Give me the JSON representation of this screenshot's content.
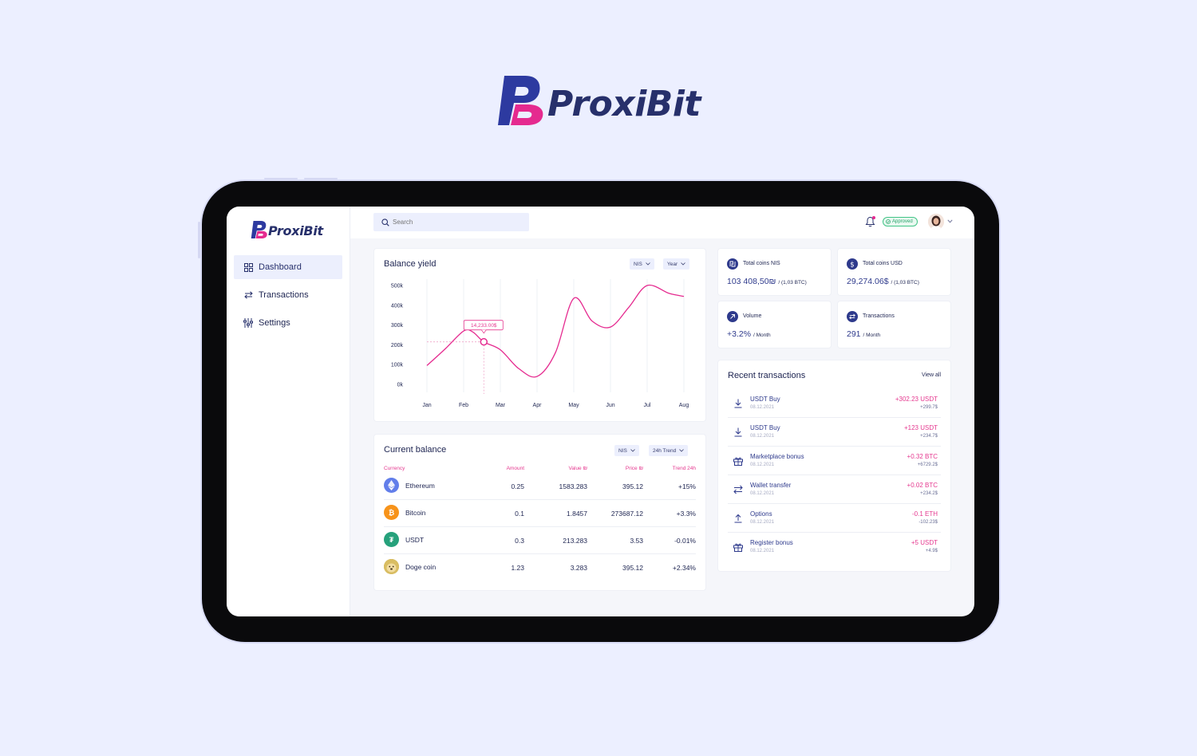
{
  "brand": {
    "name": "ProxiBit",
    "colors": {
      "primary": "#2d3aa0",
      "accent": "#e52a8f",
      "text": "#27306b"
    }
  },
  "sidebar": {
    "items": [
      {
        "label": "Dashboard",
        "icon": "grid-icon",
        "active": true
      },
      {
        "label": "Transactions",
        "icon": "arrows-swap-icon",
        "active": false
      },
      {
        "label": "Settings",
        "icon": "sliders-icon",
        "active": false
      }
    ]
  },
  "topbar": {
    "search_placeholder": "Search",
    "status_badge": "Approved"
  },
  "balance_yield": {
    "title": "Balance yield",
    "currency_filter": "NIS",
    "period_filter": "Year",
    "tooltip": "14,233.00$"
  },
  "chart_data": {
    "type": "line",
    "title": "Balance yield",
    "categories": [
      "Jan",
      "Feb",
      "Mar",
      "Apr",
      "May",
      "Jun",
      "Jul",
      "Aug"
    ],
    "y_ticks": [
      "500k",
      "400k",
      "300k",
      "200k",
      "100k",
      "0k"
    ],
    "ylim": [
      0,
      500000
    ],
    "series": [
      {
        "color": "#e52a8f",
        "x": [
          0,
          0.5,
          1,
          1.25,
          1.55,
          2,
          2.5,
          3,
          3.5,
          4,
          4.5,
          5,
          5.5,
          6,
          6.6,
          7
        ],
        "values": [
          95000,
          180000,
          270000,
          265000,
          215000,
          175000,
          80000,
          40000,
          160000,
          435000,
          320000,
          290000,
          390000,
          500000,
          460000,
          445000
        ]
      }
    ],
    "highlight": {
      "x": 1.55,
      "value": 215000,
      "label": "14,233.00$"
    },
    "grid": "vertical"
  },
  "stats": [
    {
      "label": "Total coins NIS",
      "value": "103 408,50₪",
      "sub": "/ (1,03 BTC)",
      "icon": "shekel-icon"
    },
    {
      "label": "Total coins USD",
      "value": "29,274.06$",
      "sub": "/ (1,03 BTC)",
      "icon": "dollar-icon"
    },
    {
      "label": "Volume",
      "value": "+3.2%",
      "sub": "/ Month",
      "icon": "arrow-up-right-icon"
    },
    {
      "label": "Transactions",
      "value": "291",
      "sub": "/ Month",
      "icon": "arrows-swap-icon"
    }
  ],
  "current_balance": {
    "title": "Current balance",
    "currency_filter": "NIS",
    "trend_filter": "24h Trend",
    "columns": [
      "Currency",
      "Amount",
      "Value ₪",
      "Price ₪",
      "Trend 24h"
    ],
    "rows": [
      {
        "name": "Ethereum",
        "amount": "0.25",
        "value": "1583.283",
        "price": "395.12",
        "trend": "+15%",
        "icon": "ethereum-icon",
        "color": "#627eea"
      },
      {
        "name": "Bitcoin",
        "amount": "0.1",
        "value": "1.8457",
        "price": "273687.12",
        "trend": "+3.3%",
        "icon": "bitcoin-icon",
        "color": "#f7931a"
      },
      {
        "name": "USDT",
        "amount": "0.3",
        "value": "213.283",
        "price": "3.53",
        "trend": "-0.01%",
        "icon": "tether-icon",
        "color": "#26a17b"
      },
      {
        "name": "Doge coin",
        "amount": "1.23",
        "value": "3.283",
        "price": "395.12",
        "trend": "+2.34%",
        "icon": "dogecoin-icon",
        "color": "#c2a633"
      }
    ]
  },
  "recent_transactions": {
    "title": "Recent transactions",
    "view_all": "View all",
    "items": [
      {
        "name": "USDT Buy",
        "date": "08.12.2021",
        "amount": "+302.23 USDT",
        "sub": "+299.7$",
        "icon": "download-icon"
      },
      {
        "name": "USDT Buy",
        "date": "08.12.2021",
        "amount": "+123 USDT",
        "sub": "+234.7$",
        "icon": "download-icon"
      },
      {
        "name": "Marketplace bonus",
        "date": "08.12.2021",
        "amount": "+0.32 BTC",
        "sub": "+6729.2$",
        "icon": "gift-icon"
      },
      {
        "name": "Wallet transfer",
        "date": "08.12.2021",
        "amount": "+0.02 BTC",
        "sub": "+234.2$",
        "icon": "arrows-swap-icon"
      },
      {
        "name": "Options",
        "date": "08.12.2021",
        "amount": "-0.1 ETH",
        "sub": "-102.23$",
        "icon": "upload-icon"
      },
      {
        "name": "Register bonus",
        "date": "08.12.2021",
        "amount": "+5 USDT",
        "sub": "+4.9$",
        "icon": "gift-icon"
      }
    ]
  }
}
